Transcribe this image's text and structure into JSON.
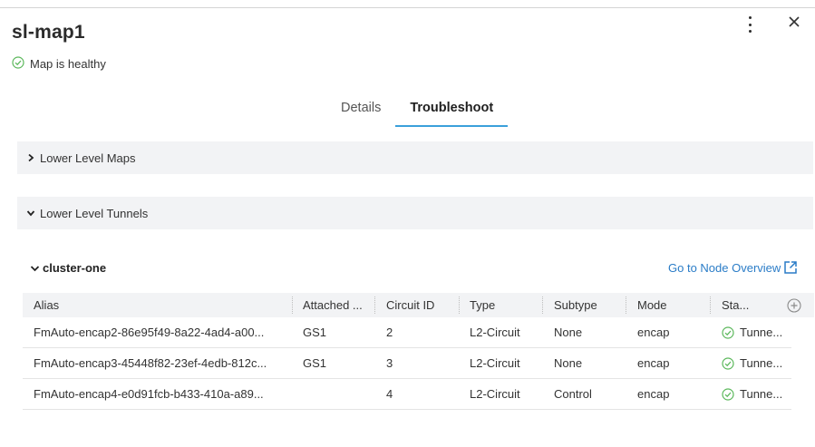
{
  "header": {
    "title": "sl-map1",
    "health_text": "Map is healthy"
  },
  "tabs": [
    {
      "label": "Details",
      "active": false
    },
    {
      "label": "Troubleshoot",
      "active": true
    }
  ],
  "sections": {
    "lower_level_maps": {
      "label": "Lower Level Maps",
      "expanded": false
    },
    "lower_level_tunnels": {
      "label": "Lower Level Tunnels",
      "expanded": true
    }
  },
  "cluster": {
    "name": "cluster-one",
    "go_to_label": "Go to Node Overview"
  },
  "table": {
    "columns": [
      "Alias",
      "Attached ...",
      "Circuit ID",
      "Type",
      "Subtype",
      "Mode",
      "Sta..."
    ],
    "rows": [
      {
        "alias": "FmAuto-encap2-86e95f49-8a22-4ad4-a00...",
        "attached": "GS1",
        "circuit_id": "2",
        "type": "L2-Circuit",
        "subtype": "None",
        "mode": "encap",
        "status": "Tunne..."
      },
      {
        "alias": "FmAuto-encap3-45448f82-23ef-4edb-812c...",
        "attached": "GS1",
        "circuit_id": "3",
        "type": "L2-Circuit",
        "subtype": "None",
        "mode": "encap",
        "status": "Tunne..."
      },
      {
        "alias": "FmAuto-encap4-e0d91fcb-b433-410a-a89...",
        "attached": "",
        "circuit_id": "4",
        "type": "L2-Circuit",
        "subtype": "Control",
        "mode": "encap",
        "status": "Tunne..."
      }
    ]
  },
  "icons": {
    "healthy": "check-circle-icon",
    "more": "kebab-menu-icon",
    "close": "close-icon",
    "collapsed": "chevron-right-icon",
    "expanded": "chevron-down-icon",
    "external": "external-link-icon",
    "add_column": "plus-circle-icon",
    "status": "check-circle-icon"
  },
  "colors": {
    "accent": "#3aa0da",
    "link": "#2a7cc7",
    "success": "#5cb85c",
    "section_bg": "#f2f3f5"
  }
}
